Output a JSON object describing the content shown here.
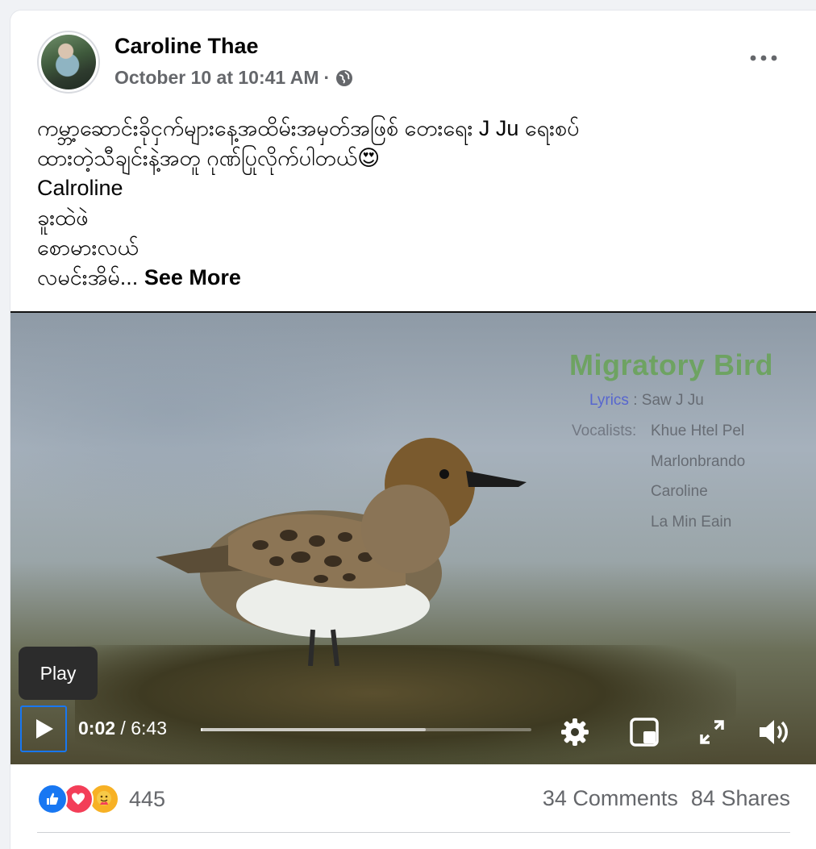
{
  "post": {
    "author": "Caroline Thae",
    "timestamp": "October 10 at 10:41 AM",
    "separator": "·",
    "privacy_icon": "globe-icon",
    "more_icon": "more-horizontal-icon",
    "text_lines": [
      "ကမ္ဘာ့ဆောင်းခိုငှက်များနေ့အထိမ်းအမှတ်အဖြစ် တေးရေး J Ju ရေးစပ်",
      "ထားတဲ့သီချင်းနဲ့အတူ ဂုဏ်ပြုလိုက်ပါတယ်😍",
      "Calroline",
      "ခူးထဲဖဲ",
      "စောမားလယ်"
    ],
    "last_line": "လမင်းအိမ်...",
    "see_more_label": "See More"
  },
  "video": {
    "title": "Migratory Bird",
    "lyrics_key": "Lyrics",
    "lyrics_sep": " : ",
    "lyrics_value": "Saw J Ju",
    "vocalists_key": "Vocalists:",
    "vocalists": [
      "Khue Htel Pel",
      "Marlonbrando",
      "Caroline",
      "La Min Eain"
    ],
    "tooltip": "Play",
    "current_time": "0:02",
    "time_sep": " / ",
    "duration": "6:43",
    "played_fraction": 0.005,
    "buffered_fraction": 0.68
  },
  "footer": {
    "reactions": [
      "like-icon",
      "love-icon",
      "care-icon"
    ],
    "reaction_count": "445",
    "comments": "34 Comments",
    "shares": "84 Shares"
  },
  "colors": {
    "facebook_blue": "#1877f2",
    "love_red": "#f33e58",
    "care_yellow": "#f7b125",
    "secondary_text": "#65676b"
  }
}
